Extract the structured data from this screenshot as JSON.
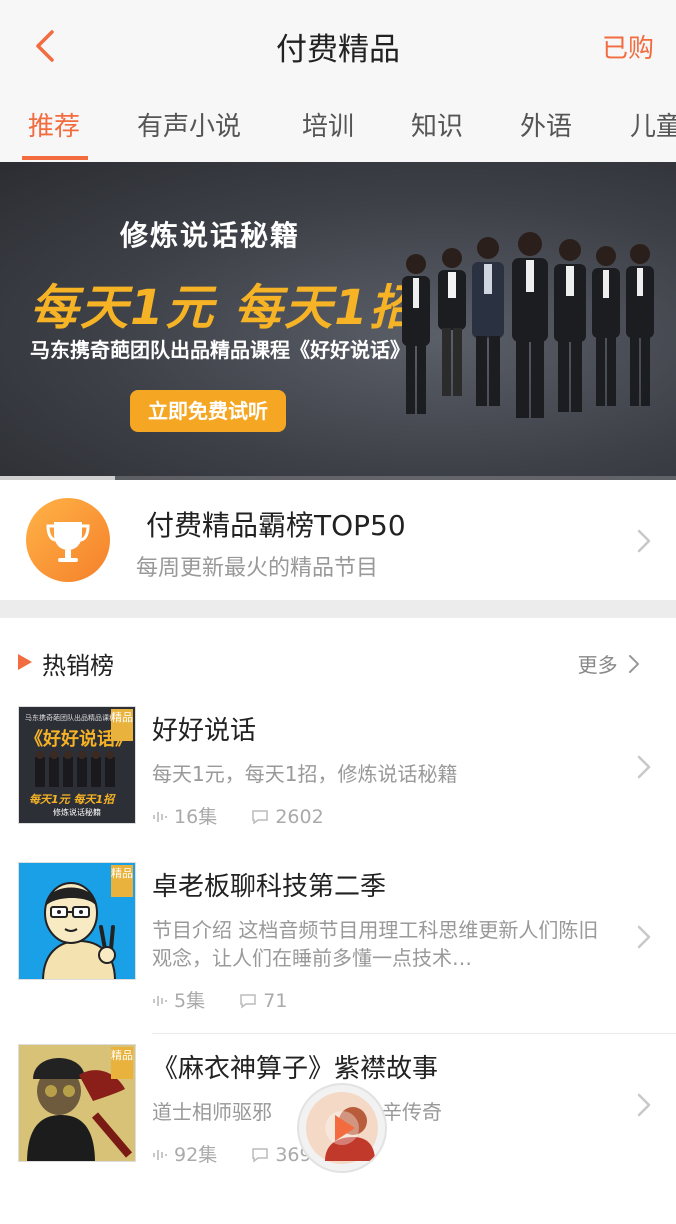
{
  "header": {
    "title": "付费精品",
    "right_action": "已购"
  },
  "tabs": [
    {
      "label": "推荐",
      "active": true
    },
    {
      "label": "有声小说",
      "active": false
    },
    {
      "label": "培训",
      "active": false
    },
    {
      "label": "知识",
      "active": false
    },
    {
      "label": "外语",
      "active": false
    },
    {
      "label": "儿童",
      "active": false
    }
  ],
  "banner": {
    "subtitle": "修炼说话秘籍",
    "headline": "每天1元 每天1招",
    "description": "马东携奇葩团队出品精品课程《好好说话》",
    "button": "立即免费试听",
    "progress": 0.17
  },
  "top50": {
    "title": "付费精品霸榜TOP50",
    "subtitle": "每周更新最火的精品节目"
  },
  "hot": {
    "title": "热销榜",
    "more": "更多",
    "items": [
      {
        "title": "好好说话",
        "desc": "每天1元，每天1招，修炼说话秘籍",
        "episodes": "16集",
        "comments": "2602",
        "tag": "精品"
      },
      {
        "title": "卓老板聊科技第二季",
        "desc": "节目介绍 这档音频节目用理工科思维更新人们陈旧观念，让人们在睡前多懂一点技术…",
        "episodes": "5集",
        "comments": "71",
        "tag": "精品"
      },
      {
        "title": "《麻衣神算子》紫襟故事",
        "desc": "道士相师驱邪",
        "desc_tail": "辛传奇",
        "episodes": "92集",
        "comments": "369",
        "tag": "精品"
      }
    ]
  },
  "cover_texts": {
    "item1_top": "马东携奇葩团队出品精品课程",
    "item1_title": "《好好说话》",
    "item1_bottom": "每天1元 每天1招",
    "item1_sub": "修炼说话秘籍"
  },
  "colors": {
    "accent": "#f26c3f",
    "gold": "#f5a623"
  }
}
